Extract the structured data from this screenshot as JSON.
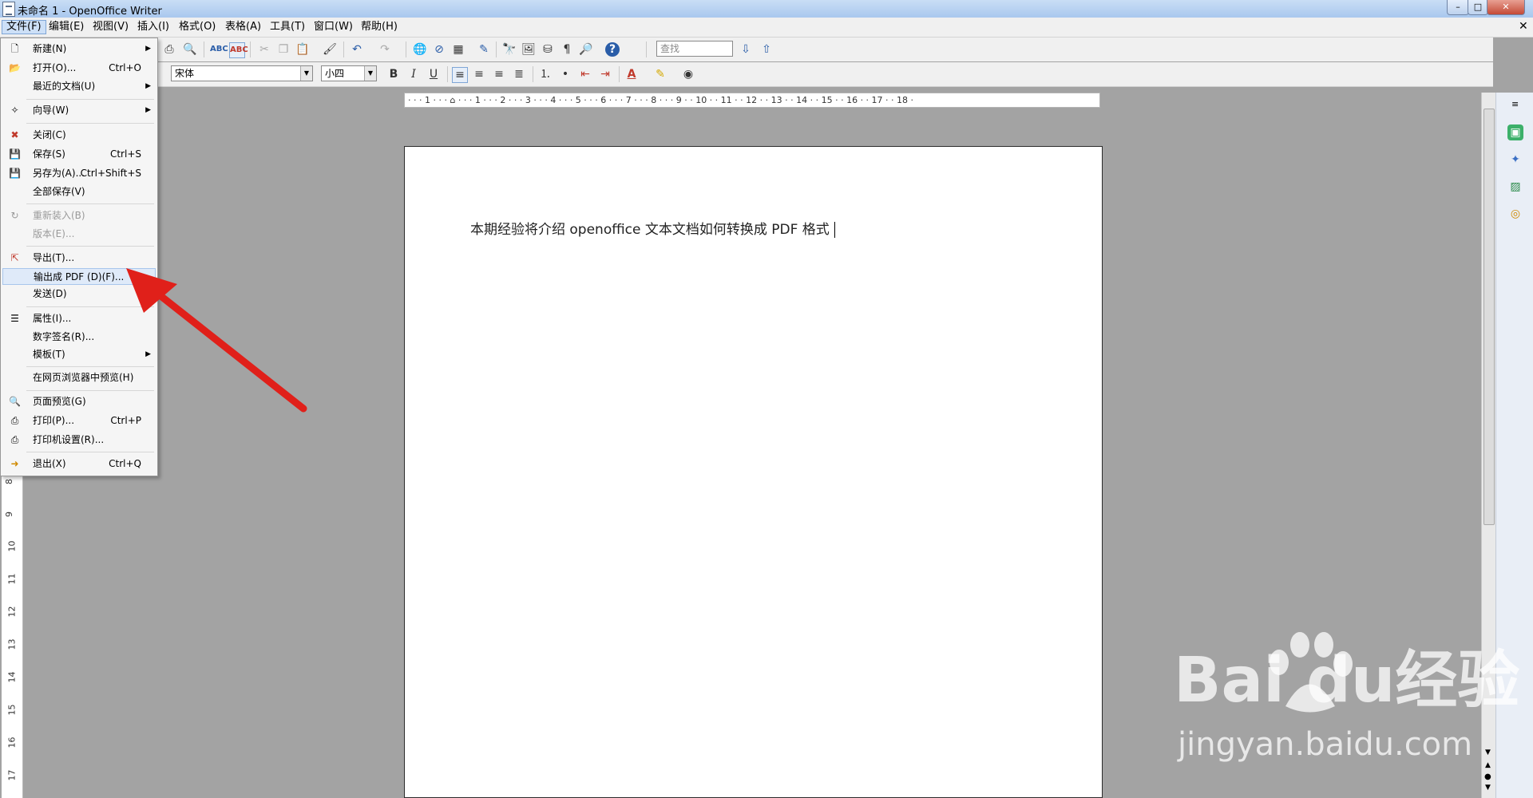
{
  "window": {
    "title": "未命名 1 - OpenOffice Writer",
    "minimize": "–",
    "maximize": "□",
    "close": "✕"
  },
  "menubar": {
    "items": [
      "文件(F)",
      "编辑(E)",
      "视图(V)",
      "插入(I)",
      "格式(O)",
      "表格(A)",
      "工具(T)",
      "窗口(W)",
      "帮助(H)"
    ],
    "doc_close": "✕"
  },
  "toolbar": {
    "find_placeholder": "查找",
    "font_name": "宋体",
    "font_size": "小四",
    "bold": "B",
    "italic": "I",
    "underline": "U"
  },
  "ruler": {
    "horizontal": "· · · 1 · · · ⌂ · · · 1 · · · 2 · · · 3 · · · 4 · · · 5 · · · 6 · · · 7 · · · 8 · · · 9 · · 10 · · 11 · · 12 · · 13 · · 14 · · 15 · · 16 · · 17 · · 18 ·",
    "vertical": [
      "8",
      "9",
      "10",
      "11",
      "12",
      "13",
      "14",
      "15",
      "16",
      "17"
    ]
  },
  "file_menu": {
    "items": [
      {
        "label": "新建(N)",
        "shortcut": "",
        "submenu": true,
        "icon": "new-doc-icon",
        "disabled": false
      },
      {
        "label": "打开(O)...",
        "shortcut": "Ctrl+O",
        "submenu": false,
        "icon": "open-folder-icon",
        "disabled": false
      },
      {
        "label": "最近的文档(U)",
        "shortcut": "",
        "submenu": true,
        "icon": "",
        "disabled": false
      },
      {
        "label": "向导(W)",
        "shortcut": "",
        "submenu": true,
        "icon": "wizard-icon",
        "disabled": false
      },
      {
        "label": "关闭(C)",
        "shortcut": "",
        "submenu": false,
        "icon": "close-doc-icon",
        "disabled": false
      },
      {
        "label": "保存(S)",
        "shortcut": "Ctrl+S",
        "submenu": false,
        "icon": "save-icon",
        "disabled": false
      },
      {
        "label": "另存为(A)...",
        "shortcut": "Ctrl+Shift+S",
        "submenu": false,
        "icon": "save-as-icon",
        "disabled": false
      },
      {
        "label": "全部保存(V)",
        "shortcut": "",
        "submenu": false,
        "icon": "",
        "disabled": false
      },
      {
        "label": "重新装入(B)",
        "shortcut": "",
        "submenu": false,
        "icon": "reload-icon",
        "disabled": true
      },
      {
        "label": "版本(E)...",
        "shortcut": "",
        "submenu": false,
        "icon": "",
        "disabled": true
      },
      {
        "label": "导出(T)...",
        "shortcut": "",
        "submenu": false,
        "icon": "export-icon",
        "disabled": false
      },
      {
        "label": "输出成 PDF (D)(F)...",
        "shortcut": "",
        "submenu": false,
        "icon": "",
        "disabled": false
      },
      {
        "label": "发送(D)",
        "shortcut": "",
        "submenu": false,
        "icon": "",
        "disabled": false
      },
      {
        "label": "属性(I)...",
        "shortcut": "",
        "submenu": false,
        "icon": "properties-icon",
        "disabled": false
      },
      {
        "label": "数字签名(R)...",
        "shortcut": "",
        "submenu": false,
        "icon": "",
        "disabled": false
      },
      {
        "label": "模板(T)",
        "shortcut": "",
        "submenu": true,
        "icon": "",
        "disabled": false
      },
      {
        "label": "在网页浏览器中预览(H)",
        "shortcut": "",
        "submenu": false,
        "icon": "",
        "disabled": false
      },
      {
        "label": "页面预览(G)",
        "shortcut": "",
        "submenu": false,
        "icon": "page-preview-icon",
        "disabled": false
      },
      {
        "label": "打印(P)...",
        "shortcut": "Ctrl+P",
        "submenu": false,
        "icon": "print-icon",
        "disabled": false
      },
      {
        "label": "打印机设置(R)...",
        "shortcut": "",
        "submenu": false,
        "icon": "printer-settings-icon",
        "disabled": false
      },
      {
        "label": "退出(X)",
        "shortcut": "Ctrl+Q",
        "submenu": false,
        "icon": "exit-icon",
        "disabled": false
      }
    ]
  },
  "document": {
    "text": "本期经验将介绍 openoffice 文本文档如何转换成 PDF 格式"
  },
  "watermark": {
    "logo": "Bai  du经验",
    "url": "jingyan.baidu.com"
  },
  "colors": {
    "arrow": "#e0201a",
    "menu_highlight": "#dfeaf9"
  }
}
